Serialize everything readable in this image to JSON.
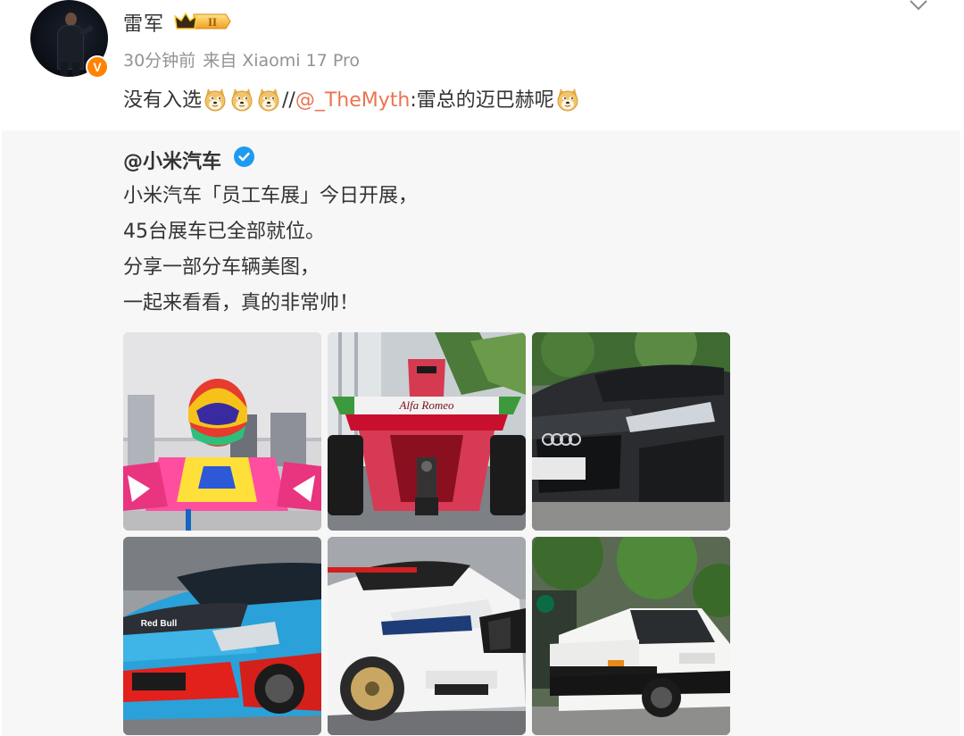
{
  "post": {
    "author": "雷军",
    "member_level": "II",
    "time": "30分钟前",
    "source": "来自 Xiaomi 17 Pro",
    "text_before": "没有入选",
    "separator": "//",
    "mention": "@_TheMyth",
    "colon": ":",
    "text_after": "雷总的迈巴赫呢",
    "emoji_name": "doge-emoji"
  },
  "repost": {
    "author": "@小米汽车",
    "lines": [
      "小米汽车「员工车展」今日开展，",
      "45台展车已全部就位。",
      "分享一部分车辆美图，",
      "一起来看看，真的非常帅！"
    ],
    "images": [
      {
        "name": "go-kart-photo"
      },
      {
        "name": "alfa-romeo-f1-car-photo",
        "label": "Alfa Romeo"
      },
      {
        "name": "audi-sedan-photo"
      },
      {
        "name": "red-bull-race-car-photo",
        "label": "Red Bull"
      },
      {
        "name": "bmw-race-car-photo"
      },
      {
        "name": "toyota-ae86-photo"
      }
    ]
  },
  "colors": {
    "mention": "#eb7350",
    "meta": "#939393",
    "verified": "#1e9bf0",
    "v_badge": "#ff8200",
    "repost_bg": "#f7f7f7"
  }
}
